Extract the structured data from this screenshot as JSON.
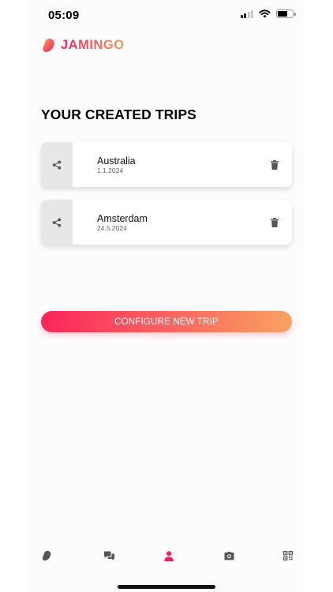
{
  "status_bar": {
    "time": "05:09"
  },
  "header": {
    "logo_text": "JAMINGO"
  },
  "page": {
    "title": "YOUR CREATED TRIPS"
  },
  "trips": [
    {
      "name": "Australia",
      "date": "1.1.2024"
    },
    {
      "name": "Amsterdam",
      "date": "24.5.2024"
    }
  ],
  "actions": {
    "configure_label": "CONFIGURE NEW TRIP"
  },
  "bottom_nav": {
    "items": [
      {
        "icon": "jamingo-logo-icon",
        "active": false
      },
      {
        "icon": "chat-icon",
        "active": false
      },
      {
        "icon": "profile-icon",
        "active": true
      },
      {
        "icon": "camera-icon",
        "active": false
      },
      {
        "icon": "qr-code-icon",
        "active": false
      }
    ]
  },
  "colors": {
    "accent": "#f5205a",
    "gradient_end": "#f9a260",
    "nav_inactive": "#555555"
  }
}
